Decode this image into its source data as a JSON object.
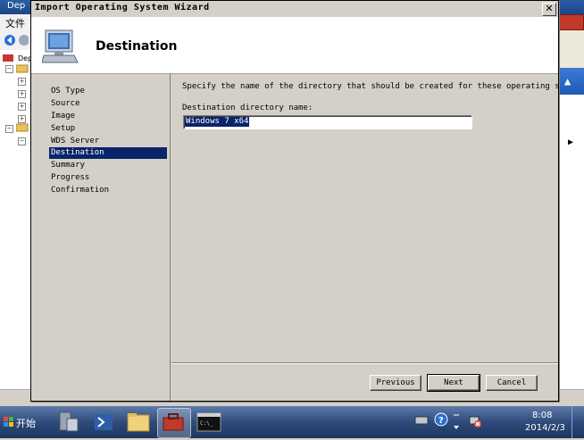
{
  "background_app": {
    "title_fragment": "Dep",
    "menu_item": "文件（",
    "tree_nodes": [
      "Dep"
    ]
  },
  "wizard": {
    "title": "Import Operating System Wizard",
    "close_glyph": "✕",
    "header_title": "Destination",
    "steps": [
      {
        "label": "OS Type",
        "active": false
      },
      {
        "label": "Source",
        "active": false
      },
      {
        "label": "Image",
        "active": false
      },
      {
        "label": "Setup",
        "active": false
      },
      {
        "label": "WDS Server",
        "active": false
      },
      {
        "label": "Destination",
        "active": true
      },
      {
        "label": "Summary",
        "active": false
      },
      {
        "label": "Progress",
        "active": false
      },
      {
        "label": "Confirmation",
        "active": false
      }
    ],
    "instruction": "Specify the name of the directory that should be created for these operating system fi",
    "field_label": "Destination directory name:",
    "field_value": "Windows 7 x64",
    "buttons": {
      "previous": "Previous",
      "next": "Next",
      "cancel": "Cancel"
    }
  },
  "taskbar": {
    "start_label": "开始",
    "time": "8:08",
    "date": "2014/2/3"
  },
  "colors": {
    "selection": "#0a246a",
    "dialog_face": "#d4d0c8",
    "taskbar": "#2f4b7b"
  }
}
